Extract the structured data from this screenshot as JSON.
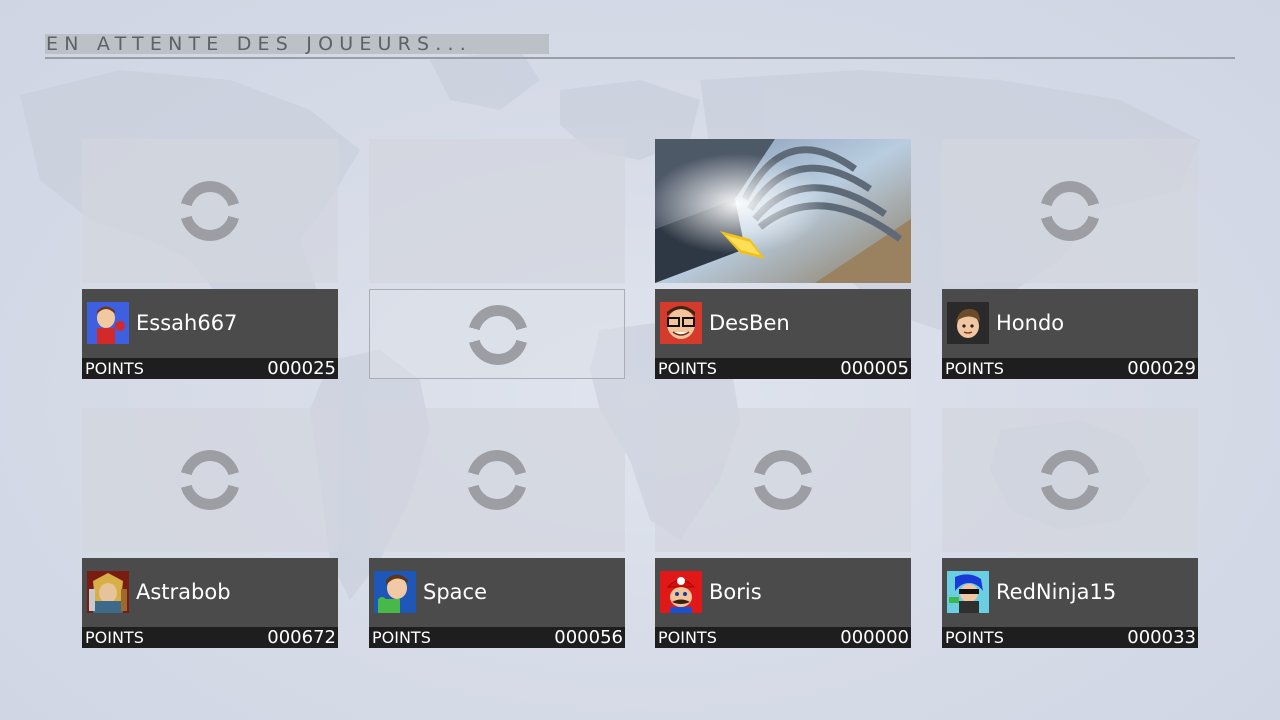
{
  "header": {
    "title": "EN ATTENTE DES JOUEURS..."
  },
  "points_label": "POINTS",
  "slots": [
    {
      "state": "ready",
      "name": "Essah667",
      "points": "000025",
      "avatar": "mii-red-shirt-icon"
    },
    {
      "state": "empty"
    },
    {
      "state": "ready",
      "name": "DesBen",
      "points": "000005",
      "avatar": "mii-glasses-icon",
      "preview": "level-preview-tunnel"
    },
    {
      "state": "ready",
      "name": "Hondo",
      "points": "000029",
      "avatar": "mii-brown-hair-icon"
    },
    {
      "state": "ready",
      "name": "Astrabob",
      "points": "000672",
      "avatar": "link-character-icon"
    },
    {
      "state": "ready",
      "name": "Space",
      "points": "000056",
      "avatar": "mii-green-shirt-icon"
    },
    {
      "state": "ready",
      "name": "Boris",
      "points": "000000",
      "avatar": "mario-icon"
    },
    {
      "state": "ready",
      "name": "RedNinja15",
      "points": "000033",
      "avatar": "inkling-icon"
    }
  ],
  "colors": {
    "card_background": "#4b4b4b",
    "points_bar": "#1e1e1e",
    "spinner": "#9c9ea3",
    "page_background": "#d7dce8"
  }
}
